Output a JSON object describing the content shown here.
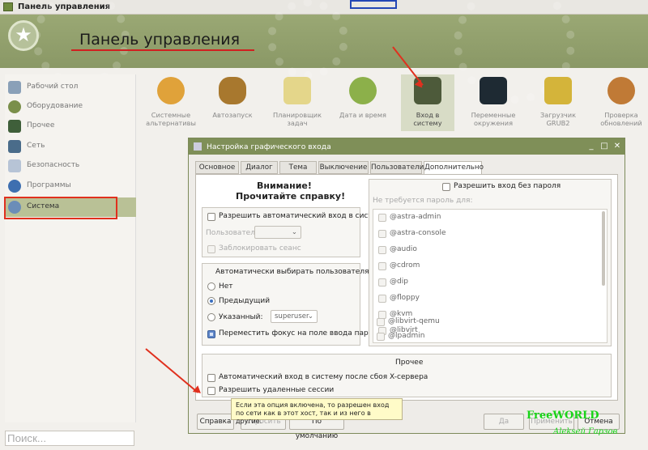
{
  "window": {
    "title": "Панель управления"
  },
  "banner": {
    "title": "Панель управления"
  },
  "sidebar": {
    "items": [
      {
        "label": "Рабочий стол",
        "icon": "desktop-icon"
      },
      {
        "label": "Оборудование",
        "icon": "hardware-icon"
      },
      {
        "label": "Прочее",
        "icon": "other-icon"
      },
      {
        "label": "Сеть",
        "icon": "network-icon"
      },
      {
        "label": "Безопасность",
        "icon": "security-icon"
      },
      {
        "label": "Программы",
        "icon": "programs-icon"
      },
      {
        "label": "Система",
        "icon": "system-icon",
        "selected": true
      }
    ],
    "search_placeholder": "Поиск..."
  },
  "apps": [
    {
      "label": "Системные альтернативы"
    },
    {
      "label": "Автозапуск"
    },
    {
      "label": "Планировщик задач"
    },
    {
      "label": "Дата и время"
    },
    {
      "label": "Вход в систему",
      "selected": true
    },
    {
      "label": "Переменные окружения"
    },
    {
      "label": "Загрузчик GRUB2"
    },
    {
      "label": "Проверка обновлений"
    }
  ],
  "dialog": {
    "title": "Настройка графического входа",
    "tabs": [
      "Основное",
      "Диалог",
      "Тема",
      "Выключение",
      "Пользователи",
      "Дополнительно"
    ],
    "active_tab": "Дополнительно",
    "warning_line1": "Внимание!",
    "warning_line2": "Прочитайте справку!",
    "autologin": {
      "label": "Разрешить автоматический вход в систему",
      "user_label": "Пользователь:",
      "lock_label": "Заблокировать сеанс"
    },
    "autoselect": {
      "title": "Автоматически выбирать пользователя",
      "none": "Нет",
      "previous": "Предыдущий",
      "specified": "Указанный:",
      "specified_value": "superuser",
      "focus_label": "Переместить фокус на поле ввода пароля"
    },
    "nopass": {
      "label": "Разрешить вход без пароля",
      "sublabel": "Не требуется пароль для:",
      "groups": [
        "@astra-admin",
        "@astra-console",
        "@audio",
        "@cdrom",
        "@dip",
        "@floppy",
        "@kvm",
        "@libvirt",
        "@libvirt-qemu",
        "@lpadmin"
      ]
    },
    "other": {
      "title": "Прочее",
      "xserver_label": "Автоматический вход в систему после сбоя X-сервера",
      "remote_label": "Разрешить удаленные сессии"
    },
    "tooltip": "Если эта опция включена, то разрешен вход по сети как в этот хост, так и из него в другие.",
    "buttons": {
      "help": "Справка",
      "ok": "Да",
      "cancel": "Отмена",
      "apply": "Применить",
      "defaults": "По умолчанию",
      "reset": "Сбросить"
    }
  },
  "watermark": {
    "main": "FreeWORLD",
    "sub": "Alekseй Гарзов"
  },
  "colors": {
    "accent": "#7f8f58",
    "highlight": "#e0301e",
    "selection": "#b9c196"
  }
}
